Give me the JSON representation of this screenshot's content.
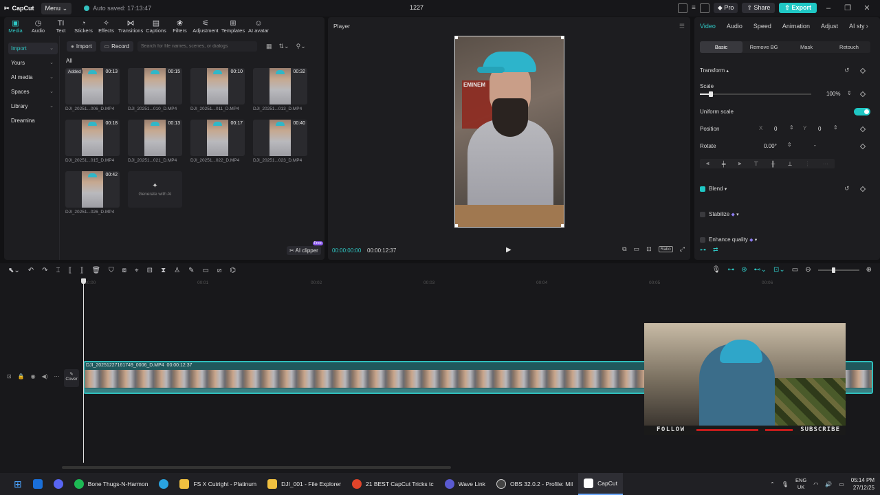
{
  "titlebar": {
    "app_name": "CapCut",
    "menu_label": "Menu",
    "autosave": "Auto saved: 17:13:47",
    "project_name": "1227",
    "pro_label": "Pro",
    "share_label": "Share",
    "export_label": "Export"
  },
  "left_panel": {
    "tabs": [
      {
        "label": "Media",
        "icon": "media-icon"
      },
      {
        "label": "Audio",
        "icon": "audio-icon"
      },
      {
        "label": "Text",
        "icon": "text-icon"
      },
      {
        "label": "Stickers",
        "icon": "stickers-icon"
      },
      {
        "label": "Effects",
        "icon": "effects-icon"
      },
      {
        "label": "Transitions",
        "icon": "transitions-icon"
      },
      {
        "label": "Captions",
        "icon": "captions-icon"
      },
      {
        "label": "Filters",
        "icon": "filters-icon"
      },
      {
        "label": "Adjustment",
        "icon": "adjustment-icon"
      },
      {
        "label": "Templates",
        "icon": "templates-icon"
      },
      {
        "label": "AI avatar",
        "icon": "ai-avatar-icon"
      }
    ],
    "sidenav": [
      "Import",
      "Yours",
      "AI media",
      "Spaces",
      "Library",
      "Dreamina"
    ],
    "import_button": "Import",
    "record_button": "Record",
    "search_placeholder": "Search for file names, scenes, or dialogs",
    "all_label": "All",
    "added_badge": "Added",
    "media": [
      {
        "name": "DJI_20251...006_D.MP4",
        "duration": "00:13"
      },
      {
        "name": "DJI_20251...010_D.MP4",
        "duration": "00:15"
      },
      {
        "name": "DJI_20251...011_D.MP4",
        "duration": "00:10"
      },
      {
        "name": "DJI_20251...013_D.MP4",
        "duration": "00:32"
      },
      {
        "name": "DJI_20251...015_D.MP4",
        "duration": "00:18"
      },
      {
        "name": "DJI_20251...021_D.MP4",
        "duration": "00:13"
      },
      {
        "name": "DJI_20251...022_D.MP4",
        "duration": "00:17"
      },
      {
        "name": "DJI_20251...023_D.MP4",
        "duration": "00:40"
      },
      {
        "name": "DJI_20251...026_D.MP4",
        "duration": "00:42"
      }
    ],
    "generate_ai": "Generate with AI",
    "ai_clipper": "AI clipper",
    "free_badge": "Free"
  },
  "player": {
    "title": "Player",
    "current_time": "00:00:00:00",
    "total_time": "00:00:12:37",
    "ratio_label": "Ratio",
    "poster_text": "EMINEM"
  },
  "right_panel": {
    "tabs": [
      "Video",
      "Audio",
      "Speed",
      "Animation",
      "Adjust",
      "AI sty"
    ],
    "subtabs": [
      "Basic",
      "Remove BG",
      "Mask",
      "Retouch"
    ],
    "transform_label": "Transform",
    "scale_label": "Scale",
    "scale_value": "100%",
    "scale_fraction": 0.1,
    "uniform_scale_label": "Uniform scale",
    "position_label": "Position",
    "pos_x_label": "X",
    "pos_x": "0",
    "pos_y_label": "Y",
    "pos_y": "0",
    "rotate_label": "Rotate",
    "rotate_value": "0.00°",
    "rotate_dash": "-",
    "blend_label": "Blend",
    "stabilize_label": "Stabilize",
    "enhance_label": "Enhance quality"
  },
  "timeline": {
    "ruler_labels": [
      "00:00",
      "00:01",
      "00:02",
      "00:03",
      "00:04",
      "00:05",
      "00:06"
    ],
    "clip_name": "DJI_20251227161749_0006_D.MP4",
    "clip_duration": "00:00:12:37",
    "cover_label": "Cover"
  },
  "webcam": {
    "follow": "FOLLOW",
    "subscribe": "SUBSCRIBE"
  },
  "taskbar": {
    "apps": [
      {
        "label": "Bone Thugs-N-Harmon",
        "color": "#1db954"
      },
      {
        "label": "FS X Cutright - Platinum",
        "color": "#f0c040"
      },
      {
        "label": "DJI_001 - File Explorer",
        "color": "#f0c040"
      },
      {
        "label": "21 BEST CapCut Tricks tc",
        "color": "#e0442a"
      },
      {
        "label": "Wave Link",
        "color": "#5a5ad0"
      },
      {
        "label": "OBS 32.0.2 - Profile: Mil",
        "color": "#444"
      },
      {
        "label": "CapCut",
        "color": "#ffffff"
      }
    ],
    "lang": "ENG",
    "region": "UK",
    "time": "05:14 PM",
    "date": "27/12/25"
  }
}
